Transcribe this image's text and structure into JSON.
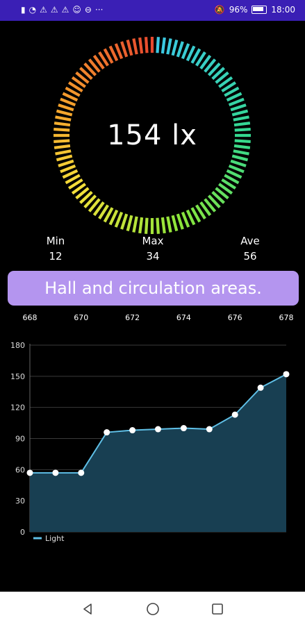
{
  "status_bar": {
    "left_icons": [
      "sim-icon",
      "wifi-icon",
      "warning-icon",
      "warning-icon",
      "warning-icon",
      "face-icon",
      "minus-circle-icon",
      "more-icon"
    ],
    "battery": "96%",
    "time": "18:00"
  },
  "gauge": {
    "value_text": "154 lx",
    "tick_count": 100,
    "colors": [
      "#e8492e",
      "#f5a32c",
      "#f4e03a",
      "#8be53a",
      "#34d88f",
      "#3cc8e8"
    ]
  },
  "stats": {
    "min": {
      "label": "Min",
      "value": "12"
    },
    "max": {
      "label": "Max",
      "value": "34"
    },
    "ave": {
      "label": "Ave",
      "value": "56"
    }
  },
  "banner": {
    "text": "Hall and circulation areas."
  },
  "chart_data": {
    "type": "area",
    "x_top_ticks": [
      "668",
      "670",
      "672",
      "674",
      "676",
      "678"
    ],
    "x": [
      668,
      669,
      670,
      671,
      672,
      673,
      674,
      675,
      676,
      677,
      678
    ],
    "series": [
      {
        "name": "Light",
        "values": [
          57,
          57,
          57,
          96,
          98,
          99,
          100,
          99,
          113,
          139,
          152
        ]
      }
    ],
    "y_ticks": [
      "0",
      "30",
      "60",
      "90",
      "120",
      "150",
      "180"
    ],
    "ylim": [
      0,
      180
    ],
    "xlim": [
      668,
      678
    ],
    "grid": true,
    "legend": "bottom-left",
    "line_color": "#5fbfe6",
    "fill_color": "#183f52"
  },
  "nav": {
    "back": "back-icon",
    "home": "home-icon",
    "recent": "recent-apps-icon"
  }
}
